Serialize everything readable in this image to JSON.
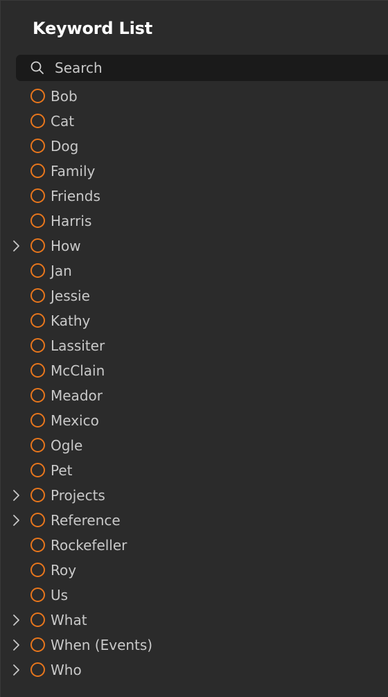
{
  "panel": {
    "title": "Keyword List"
  },
  "search": {
    "placeholder": "Search",
    "icon": "search-icon"
  },
  "colors": {
    "background": "#2b2b2b",
    "search_bg": "#1a1a1a",
    "circle": "#e8761c",
    "text": "#c9c9c9",
    "title": "#ffffff"
  },
  "keywords": [
    {
      "label": "Bob",
      "expandable": false
    },
    {
      "label": "Cat",
      "expandable": false
    },
    {
      "label": "Dog",
      "expandable": false
    },
    {
      "label": "Family",
      "expandable": false
    },
    {
      "label": "Friends",
      "expandable": false
    },
    {
      "label": "Harris",
      "expandable": false
    },
    {
      "label": "How",
      "expandable": true
    },
    {
      "label": "Jan",
      "expandable": false
    },
    {
      "label": "Jessie",
      "expandable": false
    },
    {
      "label": "Kathy",
      "expandable": false
    },
    {
      "label": "Lassiter",
      "expandable": false
    },
    {
      "label": "McClain",
      "expandable": false
    },
    {
      "label": "Meador",
      "expandable": false
    },
    {
      "label": "Mexico",
      "expandable": false
    },
    {
      "label": "Ogle",
      "expandable": false
    },
    {
      "label": "Pet",
      "expandable": false
    },
    {
      "label": "Projects",
      "expandable": true
    },
    {
      "label": "Reference",
      "expandable": true
    },
    {
      "label": "Rockefeller",
      "expandable": false
    },
    {
      "label": "Roy",
      "expandable": false
    },
    {
      "label": "Us",
      "expandable": false
    },
    {
      "label": "What",
      "expandable": true
    },
    {
      "label": "When (Events)",
      "expandable": true
    },
    {
      "label": "Who",
      "expandable": true
    }
  ]
}
